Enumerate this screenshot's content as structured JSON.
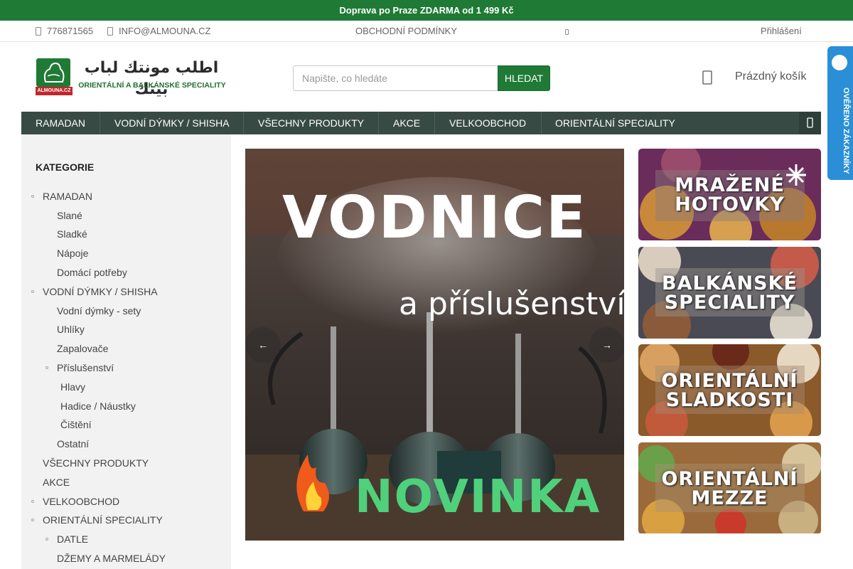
{
  "promo": {
    "text": "Doprava po Praze ZDARMA od 1 499 Kč"
  },
  "topbar": {
    "phone": "776871565",
    "email": "INFO@ALMOUNA.CZ",
    "terms": "OBCHODNÍ PODMÍNKY",
    "login": "Přihlášení"
  },
  "logo": {
    "arabic": "اطلب مونتك لباب بيتك",
    "subtitle": "ORIENTÁLNÍ A BALKÁNSKÉ SPECIALITY",
    "badge_text": "ALMOUNA.CZ"
  },
  "search": {
    "placeholder": "Napište, co hledáte",
    "button": "HLEDAT"
  },
  "cart": {
    "label": "Prázdný košík"
  },
  "nav": {
    "items": [
      {
        "label": "RAMADAN"
      },
      {
        "label": "VODNÍ DÝMKY / SHISHA"
      },
      {
        "label": "VŠECHNY PRODUKTY"
      },
      {
        "label": "AKCE"
      },
      {
        "label": "VELKOOBCHOD"
      },
      {
        "label": "ORIENTÁLNÍ SPECIALITY"
      }
    ]
  },
  "sidebar": {
    "title": "KATEGORIE",
    "items": [
      {
        "label": "RAMADAN",
        "level": 0,
        "bullet": true
      },
      {
        "label": "Slané",
        "level": 1,
        "bullet": false
      },
      {
        "label": "Sladké",
        "level": 1,
        "bullet": false
      },
      {
        "label": "Nápoje",
        "level": 1,
        "bullet": false
      },
      {
        "label": "Domácí potřeby",
        "level": 1,
        "bullet": false
      },
      {
        "label": "VODNÍ DÝMKY / SHISHA",
        "level": 0,
        "bullet": true
      },
      {
        "label": "Vodní dýmky - sety",
        "level": 1,
        "bullet": false
      },
      {
        "label": "Uhlíky",
        "level": 1,
        "bullet": false
      },
      {
        "label": "Zapalovače",
        "level": 1,
        "bullet": false
      },
      {
        "label": "Příslušenství",
        "level": 1,
        "bullet": true
      },
      {
        "label": "Hlavy",
        "level": 2,
        "bullet": false
      },
      {
        "label": "Hadice / Náustky",
        "level": 2,
        "bullet": false
      },
      {
        "label": "Čištění",
        "level": 2,
        "bullet": false
      },
      {
        "label": "Ostatní",
        "level": 1,
        "bullet": false
      },
      {
        "label": "VŠECHNY PRODUKTY",
        "level": 0,
        "bullet": false
      },
      {
        "label": "AKCE",
        "level": 0,
        "bullet": false
      },
      {
        "label": "VELKOOBCHOD",
        "level": 0,
        "bullet": true
      },
      {
        "label": "ORIENTÁLNÍ SPECIALITY",
        "level": 0,
        "bullet": true
      },
      {
        "label": "DATLE",
        "level": 1,
        "bullet": true
      },
      {
        "label": "DŽEMY A MARMELÁDY",
        "level": 1,
        "bullet": false
      }
    ]
  },
  "slider": {
    "title": "VODNICE",
    "subtitle": "a příslušenství",
    "badge": "NOVINKA",
    "prev_icon": "arrow-left-icon",
    "next_icon": "arrow-right-icon"
  },
  "banners": [
    {
      "line1": "MRAŽENÉ",
      "line2": "HOTOVKY",
      "accent": "#6a2c5a"
    },
    {
      "line1": "BALKÁNSKÉ",
      "line2": "SPECIALITY",
      "accent": "#4a4a55"
    },
    {
      "line1": "ORIENTÁLNÍ",
      "line2": "SLADKOSTI",
      "accent": "#8a5a2a"
    },
    {
      "line1": "ORIENTÁLNÍ",
      "line2": "MEZZE",
      "accent": "#9a6a3a"
    }
  ],
  "verified": {
    "text": "OVĚŘENO ZÁKAZNÍKY"
  },
  "colors": {
    "brand_green": "#1f7a35",
    "nav_bg": "#384a44",
    "sidebar_bg": "#f2f2f2",
    "verified_blue": "#2a8fd6"
  }
}
